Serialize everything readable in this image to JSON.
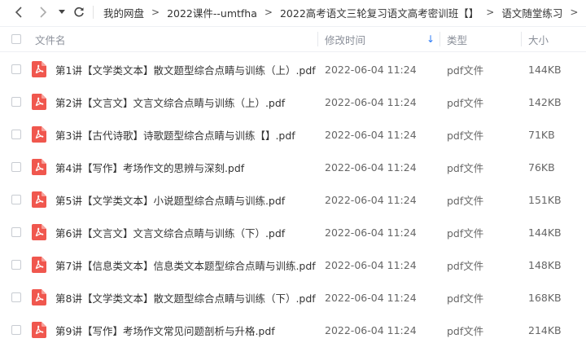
{
  "toolbar": {
    "back_icon": "chevron-left-icon",
    "forward_icon": "chevron-right-icon",
    "history_icon": "caret-down-icon",
    "refresh_icon": "refresh-icon"
  },
  "breadcrumb": [
    {
      "label": "我的网盘"
    },
    {
      "label": "2022课件--umtfha"
    },
    {
      "label": "2022高考语文三轮复习语文高考密训班【】"
    },
    {
      "label": "语文随堂练习"
    }
  ],
  "breadcrumb_separator": ">",
  "columns": {
    "name": "文件名",
    "modified": "修改时间",
    "type": "类型",
    "size": "大小"
  },
  "sort_indicator": "↓",
  "colors": {
    "accent": "#2f7cf6",
    "pdf_red": "#f0574e",
    "header_text": "#8a8f99"
  },
  "files": [
    {
      "name": "第1讲【文学类文本】散文题型综合点睛与训练（上）.pdf",
      "modified": "2022-06-04 11:24",
      "type": "pdf文件",
      "size": "144KB",
      "icon": "pdf-file-icon"
    },
    {
      "name": "第2讲【文言文】文言文综合点睛与训练（上）.pdf",
      "modified": "2022-06-04 11:24",
      "type": "pdf文件",
      "size": "142KB",
      "icon": "pdf-file-icon"
    },
    {
      "name": "第3讲【古代诗歌】诗歌题型综合点睛与训练【】.pdf",
      "modified": "2022-06-04 11:24",
      "type": "pdf文件",
      "size": "71KB",
      "icon": "pdf-file-icon"
    },
    {
      "name": "第4讲【写作】考场作文的思辨与深刻.pdf",
      "modified": "2022-06-04 11:24",
      "type": "pdf文件",
      "size": "76KB",
      "icon": "pdf-file-icon"
    },
    {
      "name": "第5讲【文学类文本】小说题型综合点睛与训练.pdf",
      "modified": "2022-06-04 11:24",
      "type": "pdf文件",
      "size": "151KB",
      "icon": "pdf-file-icon"
    },
    {
      "name": "第6讲【文言文】文言文综合点睛与训练（下）.pdf",
      "modified": "2022-06-04 11:24",
      "type": "pdf文件",
      "size": "144KB",
      "icon": "pdf-file-icon"
    },
    {
      "name": "第7讲【信息类文本】信息类文本题型综合点睛与训练.pdf",
      "modified": "2022-06-04 11:24",
      "type": "pdf文件",
      "size": "148KB",
      "icon": "pdf-file-icon"
    },
    {
      "name": "第8讲【文学类文本】散文题型综合点睛与训练（下）.pdf",
      "modified": "2022-06-04 11:24",
      "type": "pdf文件",
      "size": "168KB",
      "icon": "pdf-file-icon"
    },
    {
      "name": "第9讲【写作】考场作文常见问题剖析与升格.pdf",
      "modified": "2022-06-04 11:24",
      "type": "pdf文件",
      "size": "214KB",
      "icon": "pdf-file-icon"
    }
  ]
}
